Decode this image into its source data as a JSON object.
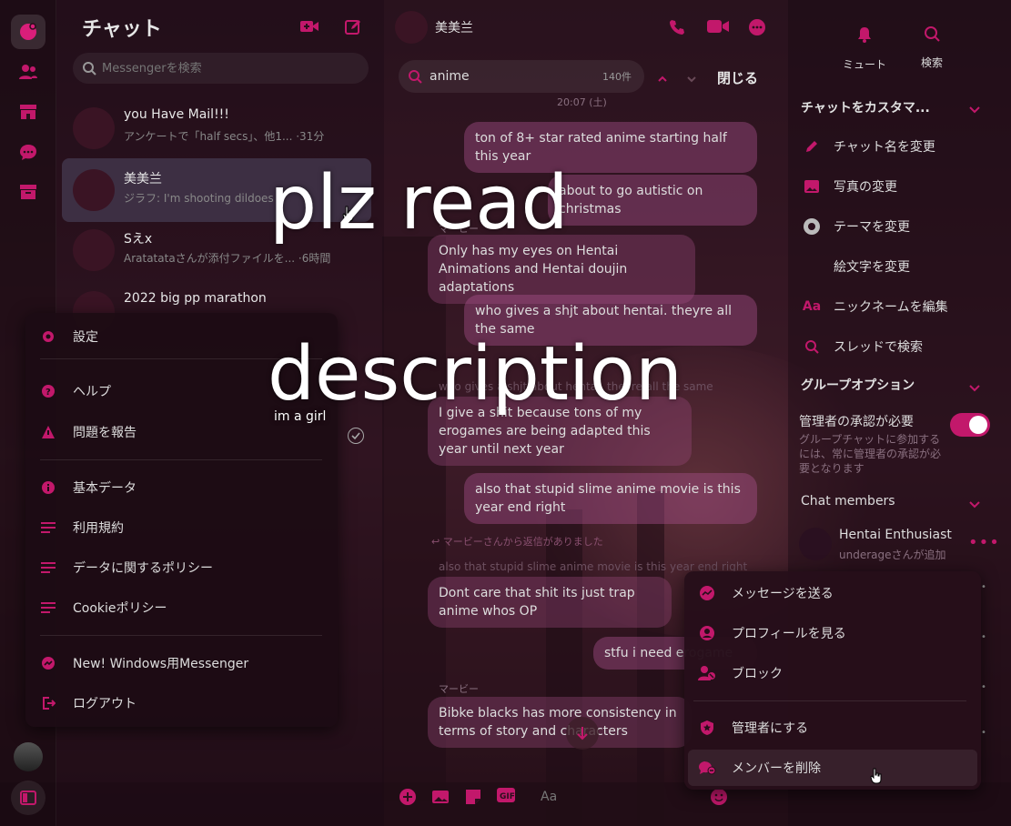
{
  "colors": {
    "accent": "#c2186b",
    "bubble": "#a0467a"
  },
  "rail": {
    "icons": [
      "chat-icon",
      "people-icon",
      "store-icon",
      "bubble-icon",
      "archive-icon"
    ]
  },
  "list": {
    "title": "チャット",
    "search_placeholder": "Messengerを検索",
    "conversations": [
      {
        "name": "you Have Mail!!!",
        "preview": "アンケートで「half secs」、他1... ·31分"
      },
      {
        "name": "美美兰",
        "preview": "ジラフ: I'm shooting dildoes"
      },
      {
        "name": "Sえx",
        "preview": "Aratatataさんが添付ファイルを... ·6時間"
      },
      {
        "name": "2022 big pp marathon",
        "preview": ""
      }
    ]
  },
  "settings_menu": {
    "items": [
      {
        "label": "設定",
        "icon": "gear-icon"
      },
      {
        "label": "ヘルプ",
        "icon": "help-icon"
      },
      {
        "label": "問題を報告",
        "icon": "warning-icon"
      },
      {
        "label": "基本データ",
        "icon": "info-icon"
      },
      {
        "label": "利用規約",
        "icon": "lines-icon"
      },
      {
        "label": "データに関するポリシー",
        "icon": "lines-icon"
      },
      {
        "label": "Cookieポリシー",
        "icon": "lines-icon"
      },
      {
        "label": "New! Windows用Messenger",
        "icon": "messenger-icon"
      },
      {
        "label": "ログアウト",
        "icon": "logout-icon"
      }
    ]
  },
  "chat": {
    "name": "美美兰",
    "search_query": "anime",
    "search_count": "140件",
    "close_label": "閉じる",
    "date_fragment": "20:07 (土)",
    "sender_label": "マービー",
    "sender_label2": "マービー",
    "reply_notice": "マービーさんから返信がありました",
    "ghost_lines": [
      "who gives a shjt about hentai. theyre all the same",
      "also that stupid slime anime movie is this year end right"
    ],
    "messages": [
      {
        "text": "ton of 8+ star rated anime starting half this year"
      },
      {
        "text": "about to go autistic on christmas"
      },
      {
        "text": "Only has my eyes on Hentai Animations and Hentai doujin adaptations"
      },
      {
        "text": "who gives a shjt about hentai. theyre all the same"
      },
      {
        "text": "I give a shit because tons of my erogames are being adapted this year until next year"
      },
      {
        "text": "also that stupid slime anime movie is this year end right"
      },
      {
        "text": "Dont care that shit its just trap anime whos OP"
      },
      {
        "text": "stfu i need erogame"
      },
      {
        "text": "Bibke blacks has more consistency in terms of story and characters"
      }
    ],
    "composer_placeholder": "Aa"
  },
  "right": {
    "mute_label": "ミュート",
    "search_label": "検索",
    "customize_title": "チャットをカスタマ...",
    "customize_items": [
      {
        "label": "チャット名を変更",
        "icon": "pencil-icon"
      },
      {
        "label": "写真の変更",
        "icon": "image-icon"
      },
      {
        "label": "テーマを変更",
        "icon": "theme-icon"
      },
      {
        "label": "絵文字を変更",
        "icon": "emoji-icon"
      },
      {
        "label": "ニックネームを編集",
        "icon": "aa-icon"
      },
      {
        "label": "スレッドで検索",
        "icon": "search-icon"
      }
    ],
    "group_title": "グループオプション",
    "approval_label": "管理者の承認が必要",
    "approval_desc": "グループチャットに参加するには、常に管理者の承認が必要となります",
    "members_title": "Chat members",
    "member": {
      "name": "Hentai Enthusiast",
      "sub": "underageさんが追加"
    }
  },
  "member_popup": {
    "items": [
      {
        "label": "メッセージを送る",
        "icon": "messenger-icon"
      },
      {
        "label": "プロフィールを見る",
        "icon": "profile-icon"
      },
      {
        "label": "ブロック",
        "icon": "block-icon"
      },
      {
        "label": "管理者にする",
        "icon": "shield-icon"
      },
      {
        "label": "メンバーを削除",
        "icon": "remove-member-icon"
      }
    ]
  },
  "overlay": {
    "line1": "plz read",
    "line2": "description",
    "caption": "im a girl"
  }
}
